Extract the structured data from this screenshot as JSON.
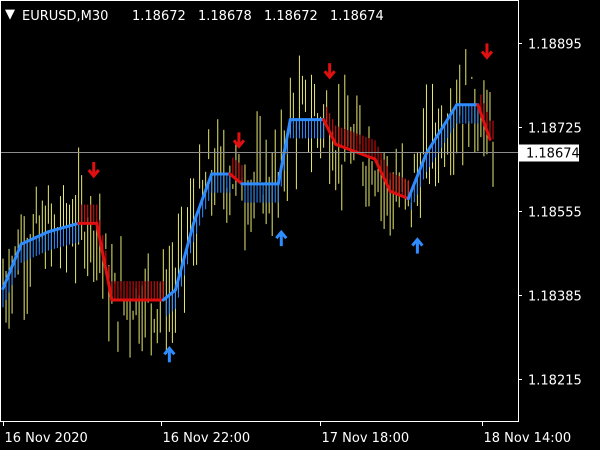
{
  "window": {
    "symbol_timeframe": "EURUSD,M30",
    "ohlc": [
      "1.18672",
      "1.18678",
      "1.18672",
      "1.18674"
    ],
    "collapse_glyph": "▼"
  },
  "colors": {
    "background": "#000000",
    "frame": "#ffffff",
    "candle": "#e8e870",
    "trend_up": "#2f8cff",
    "trend_down": "#e01010",
    "price_line": "#8c8c8c",
    "label_box_bg": "#ffffff",
    "label_box_text": "#000000"
  },
  "icons": {
    "buy": "arrow-up-icon",
    "sell": "arrow-down-icon"
  },
  "chart_data": {
    "type": "candlestick",
    "symbol": "EURUSD",
    "timeframe": "M30",
    "y_ticks": [
      "1.18895",
      "1.18725",
      "1.18555",
      "1.18385",
      "1.18215"
    ],
    "x_ticks": [
      "16 Nov 2020",
      "16 Nov 22:00",
      "17 Nov 18:00",
      "18 Nov 14:00"
    ],
    "current_price": "1.18674",
    "ylim": [
      1.1813,
      1.1898
    ],
    "grid": false,
    "trend_line": [
      {
        "t": 0,
        "v": 1.18398,
        "d": "up"
      },
      {
        "t": 6,
        "v": 1.18488,
        "d": "up"
      },
      {
        "t": 15,
        "v": 1.18513,
        "d": "up"
      },
      {
        "t": 25,
        "v": 1.1853,
        "d": "up"
      },
      {
        "t": 31,
        "v": 1.1853,
        "d": "down"
      },
      {
        "t": 36,
        "v": 1.18375,
        "d": "down"
      },
      {
        "t": 53,
        "v": 1.18375,
        "d": "down"
      },
      {
        "t": 57,
        "v": 1.18395,
        "d": "up"
      },
      {
        "t": 63,
        "v": 1.1853,
        "d": "up"
      },
      {
        "t": 69,
        "v": 1.1863,
        "d": "up"
      },
      {
        "t": 75,
        "v": 1.1863,
        "d": "up"
      },
      {
        "t": 79,
        "v": 1.1861,
        "d": "down"
      },
      {
        "t": 91,
        "v": 1.1861,
        "d": "up"
      },
      {
        "t": 95,
        "v": 1.1874,
        "d": "up"
      },
      {
        "t": 106,
        "v": 1.1874,
        "d": "up"
      },
      {
        "t": 110,
        "v": 1.1869,
        "d": "down"
      },
      {
        "t": 123,
        "v": 1.1866,
        "d": "down"
      },
      {
        "t": 128,
        "v": 1.18595,
        "d": "down"
      },
      {
        "t": 134,
        "v": 1.1858,
        "d": "down"
      },
      {
        "t": 140,
        "v": 1.18672,
        "d": "up"
      },
      {
        "t": 150,
        "v": 1.1877,
        "d": "up"
      },
      {
        "t": 157,
        "v": 1.1877,
        "d": "up"
      },
      {
        "t": 161,
        "v": 1.187,
        "d": "down"
      }
    ],
    "signals": [
      {
        "type": "sell",
        "t": 30,
        "v": 1.1864
      },
      {
        "type": "buy",
        "t": 55,
        "v": 1.18263
      },
      {
        "type": "sell",
        "t": 78,
        "v": 1.187
      },
      {
        "type": "buy",
        "t": 92,
        "v": 1.18498
      },
      {
        "type": "sell",
        "t": 108,
        "v": 1.1884
      },
      {
        "type": "buy",
        "t": 137,
        "v": 1.18483
      },
      {
        "type": "sell",
        "t": 160,
        "v": 1.1888
      }
    ],
    "num_bars": 163
  }
}
